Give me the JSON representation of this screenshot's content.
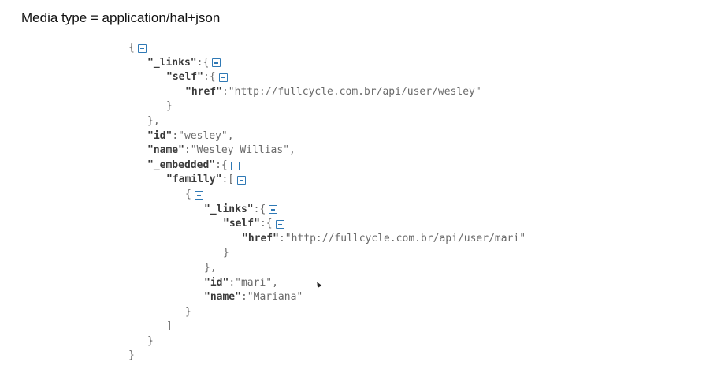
{
  "header": {
    "title": "Media type = application/hal+json"
  },
  "json": {
    "links_key": "\"_links\"",
    "self_key": "\"self\"",
    "href_key": "\"href\"",
    "root_href": "\"http://fullcycle.com.br/api/user/wesley\"",
    "id_key": "\"id\"",
    "root_id": "\"wesley\"",
    "name_key": "\"name\"",
    "root_name": "\"Wesley Willias\"",
    "embedded_key": "\"_embedded\"",
    "familly_key": "\"familly\"",
    "child_href": "\"http://fullcycle.com.br/api/user/mari\"",
    "child_id": "\"mari\"",
    "child_name": "\"Mariana\""
  },
  "colors": {
    "toggle": "#2f79b5",
    "key": "#3a3a3a",
    "value": "#6a6a6a"
  },
  "icons": {
    "toggle": "collapse-minus-icon",
    "cursor": "mouse-pointer-icon"
  }
}
